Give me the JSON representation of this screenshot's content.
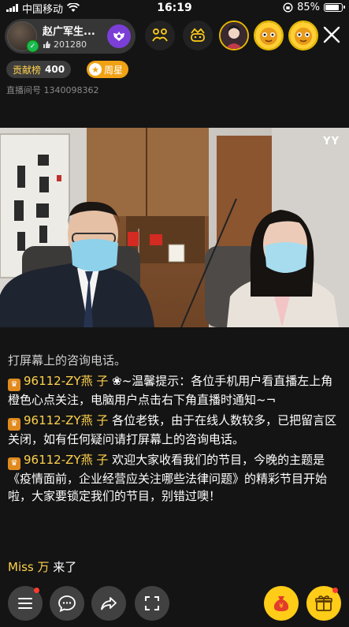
{
  "status_bar": {
    "carrier": "中国移动",
    "time": "16:19",
    "battery": "85%",
    "battery_level": 0.85
  },
  "host": {
    "name": "赵广军生...",
    "fans": "201280"
  },
  "ranking": {
    "label": "贡献榜",
    "value": "400"
  },
  "weekly_star": {
    "label": "周星"
  },
  "room": {
    "label": "直播间号",
    "id": "1340098362"
  },
  "video": {
    "watermark": "YY"
  },
  "chat": {
    "partial_line": "打屏幕上的咨询电话。",
    "messages": [
      {
        "user": "96112-ZY燕 子",
        "text": "❀~温馨提示：各位手机用户看直播左上角橙色心点关注，电脑用户点击右下角直播时通知~¬"
      },
      {
        "user": "96112-ZY燕 子",
        "text": "各位老铁，由于在线人数较多，已把留言区关闭，如有任何疑问请打屏幕上的咨询电话。"
      },
      {
        "user": "96112-ZY燕 子",
        "text": "欢迎大家收看我们的节目，今晚的主题是《疫情面前，企业经营应关注哪些法律问题》的精彩节目开始啦，大家要锁定我们的节目，别错过噢！"
      }
    ],
    "join": {
      "name": "Miss 万",
      "action": "来了"
    }
  },
  "colors": {
    "accent_gold": "#ffcc18",
    "username_yellow": "#ffd24d",
    "follow_purple": "#7b3fd8"
  }
}
